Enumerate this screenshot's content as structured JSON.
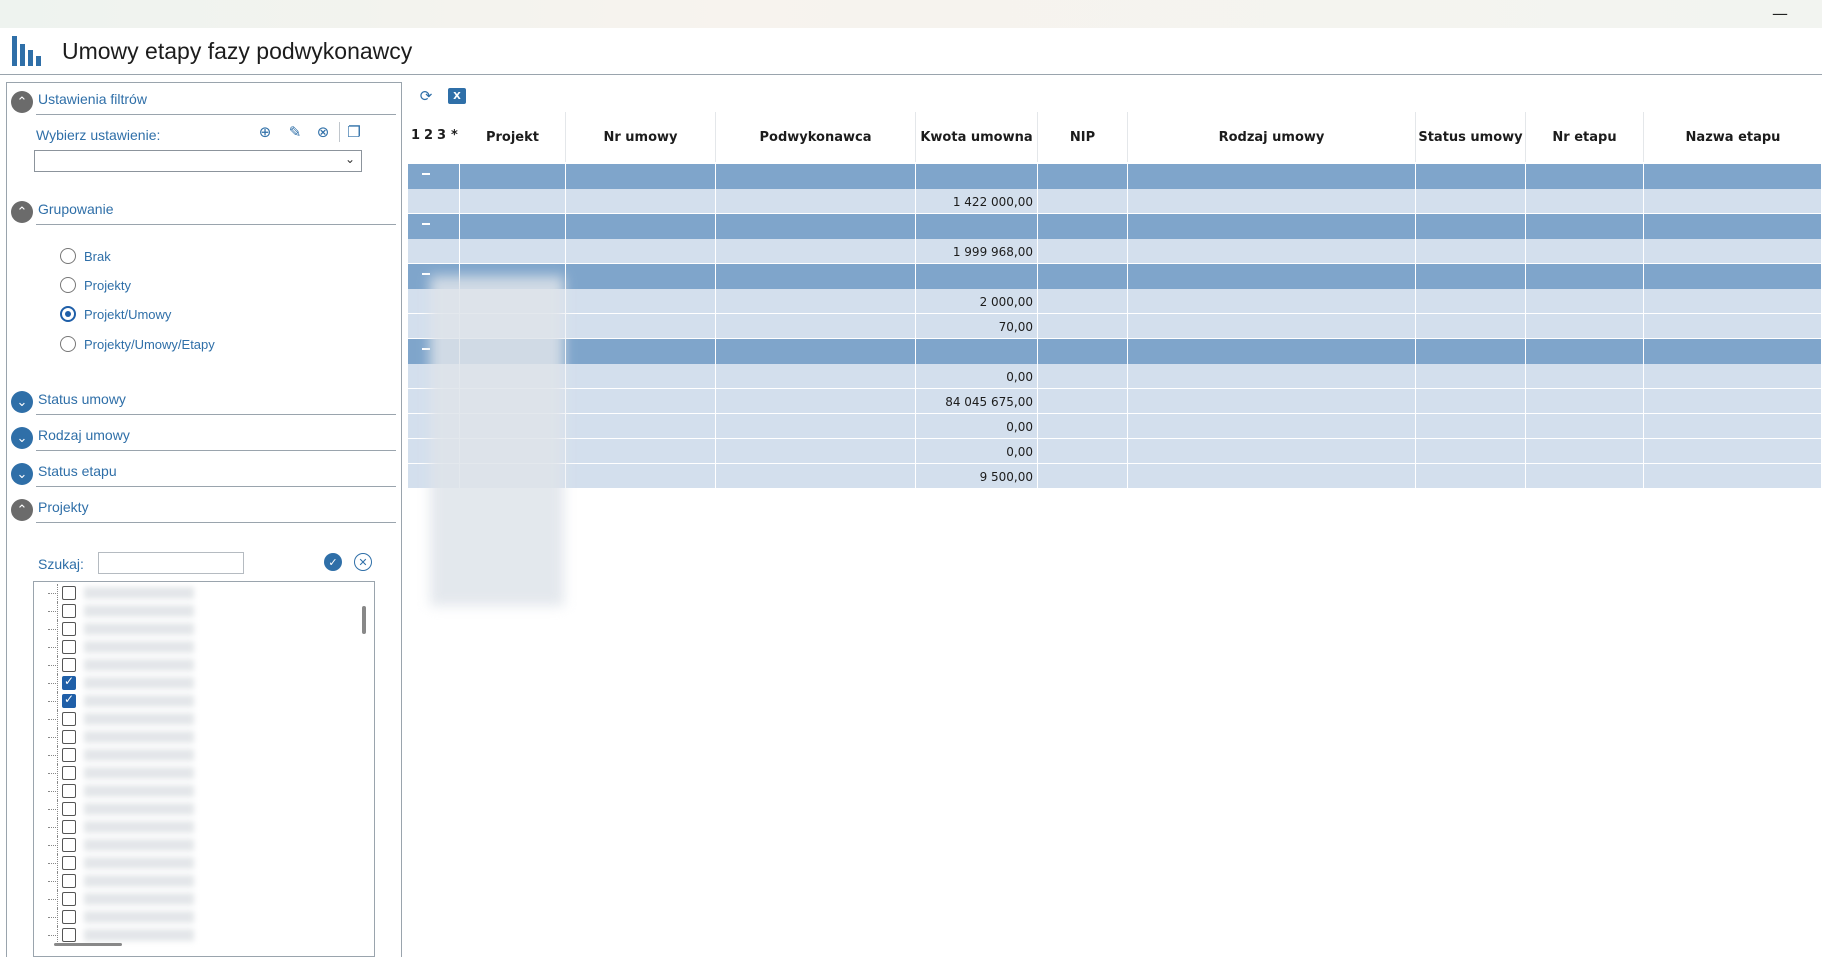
{
  "window": {
    "minimize_glyph": "—",
    "title": "Umowy etapy fazy podwykonawcy",
    "app_icon": "bar-chart-icon"
  },
  "filters": {
    "section_label": "Ustawienia filtrów",
    "select_label": "Wybierz ustawienie:",
    "select_value": "",
    "icons": [
      "add-icon",
      "edit-icon",
      "delete-icon",
      "copy-icon"
    ]
  },
  "grouping": {
    "section_label": "Grupowanie",
    "options": [
      {
        "label": "Brak",
        "checked": false
      },
      {
        "label": "Projekty",
        "checked": false
      },
      {
        "label": "Projekt/Umowy",
        "checked": true
      },
      {
        "label": "Projekty/Umowy/Etapy",
        "checked": false
      }
    ]
  },
  "collapsed_sections": [
    "Status umowy",
    "Rodzaj umowy",
    "Status etapu"
  ],
  "projects": {
    "section_label": "Projekty",
    "search_label": "Szukaj:",
    "search_value": "",
    "items_checked": [
      false,
      false,
      false,
      false,
      false,
      true,
      true,
      false,
      false,
      false,
      false,
      false,
      false,
      false,
      false,
      false,
      false,
      false,
      false,
      false
    ]
  },
  "grid": {
    "level_labels": [
      "1",
      "2",
      "3",
      "*"
    ],
    "columns": [
      "Projekt",
      "Nr umowy",
      "Podwykonawca",
      "Kwota umowna",
      "NIP",
      "Rodzaj umowy",
      "Status umowy",
      "Nr etapu",
      "Nazwa etapu"
    ],
    "rows": [
      {
        "type": "group",
        "kwota": ""
      },
      {
        "type": "data",
        "kwota": "1 422 000,00"
      },
      {
        "type": "group",
        "kwota": ""
      },
      {
        "type": "data",
        "kwota": "1 999 968,00"
      },
      {
        "type": "group",
        "kwota": ""
      },
      {
        "type": "data",
        "kwota": "2 000,00"
      },
      {
        "type": "data",
        "kwota": "70,00"
      },
      {
        "type": "group",
        "kwota": ""
      },
      {
        "type": "data",
        "kwota": "0,00"
      },
      {
        "type": "data",
        "kwota": "84 045 675,00"
      },
      {
        "type": "data",
        "kwota": "0,00"
      },
      {
        "type": "data",
        "kwota": "0,00"
      },
      {
        "type": "data",
        "kwota": "9 500,00"
      }
    ]
  },
  "colors": {
    "accent": "#2f6fa8",
    "group_row": "#7fa5cb",
    "data_row": "#d3dfed"
  }
}
